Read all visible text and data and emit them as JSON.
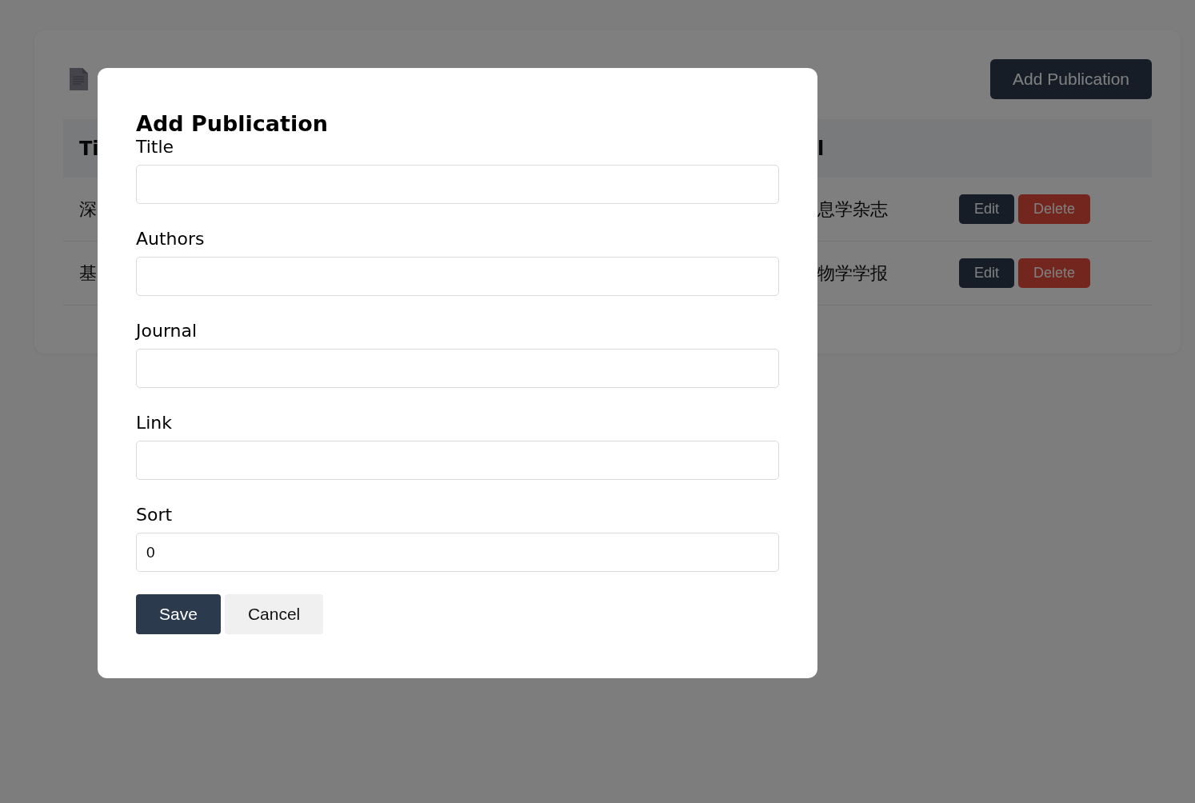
{
  "page": {
    "add_button": "Add Publication",
    "table": {
      "columns": [
        "Ti",
        "l"
      ],
      "rows": [
        {
          "cells": [
            "深",
            "息学杂志"
          ],
          "actions": [
            "Edit",
            "Delete"
          ]
        },
        {
          "cells": [
            "基",
            "物学学报"
          ],
          "actions": [
            "Edit",
            "Delete"
          ]
        }
      ]
    }
  },
  "modal": {
    "title": "Add Publication",
    "fields": [
      {
        "label": "Title"
      },
      {
        "label": "Authors"
      },
      {
        "label": "Journal"
      },
      {
        "label": "Link"
      },
      {
        "label": "Sort",
        "value": "0"
      }
    ],
    "buttons": [
      {
        "label": "Save",
        "kind": "primary"
      },
      {
        "label": "Cancel",
        "kind": "secondary"
      }
    ]
  }
}
